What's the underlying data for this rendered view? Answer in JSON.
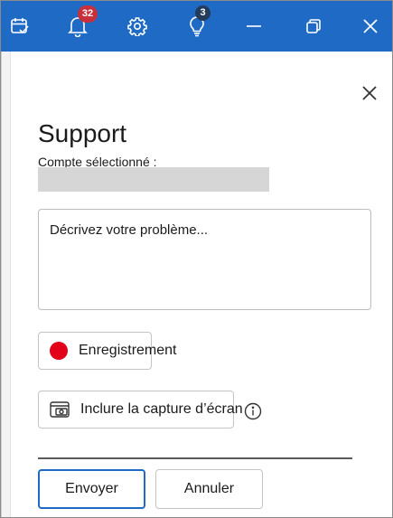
{
  "titlebar": {
    "background": "#1f6ac4",
    "icons": [
      "calendar-check-icon",
      "bell-icon",
      "gear-icon",
      "lightbulb-icon",
      "minimize-icon",
      "restore-icon",
      "close-icon"
    ],
    "notifications_count": "32",
    "tips_count": "3"
  },
  "support": {
    "title": "Support",
    "account_label": "Compte sélectionné :",
    "description_placeholder": "Décrivez votre problème...",
    "record_label": "Enregistrement",
    "screenshot_label": "Inclure la capture d’écran",
    "send_label": "Envoyer",
    "cancel_label": "Annuler"
  },
  "colors": {
    "accent": "#1f6ac4",
    "record_dot": "#e3001b",
    "badge_red": "#c7303a"
  }
}
